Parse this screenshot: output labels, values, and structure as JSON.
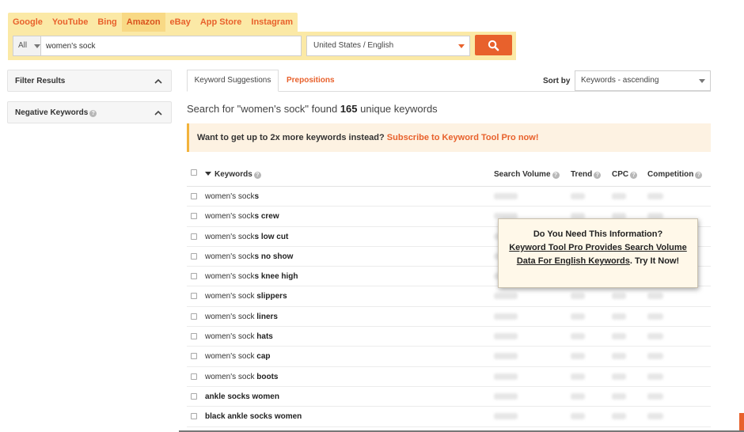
{
  "source_tabs": [
    {
      "label": "Google",
      "active": false
    },
    {
      "label": "YouTube",
      "active": false
    },
    {
      "label": "Bing",
      "active": false
    },
    {
      "label": "Amazon",
      "active": true
    },
    {
      "label": "eBay",
      "active": false
    },
    {
      "label": "App Store",
      "active": false
    },
    {
      "label": "Instagram",
      "active": false
    }
  ],
  "search": {
    "category": "All",
    "query": "women's sock",
    "location": "United States / English",
    "button_icon": "search-icon"
  },
  "sidebar": {
    "filter_results": "Filter Results",
    "negative_keywords": "Negative Keywords"
  },
  "main_tabs": {
    "suggestions": "Keyword Suggestions",
    "prepositions": "Prepositions"
  },
  "sort": {
    "label": "Sort by",
    "value": "Keywords - ascending"
  },
  "summary": {
    "prefix": "Search for \"women's sock\" found ",
    "count": "165",
    "suffix": " unique keywords"
  },
  "promo": {
    "text": "Want to get up to 2x more keywords instead? ",
    "link": "Subscribe to Keyword Tool Pro now!"
  },
  "table": {
    "headers": {
      "keywords": "Keywords",
      "search_volume": "Search Volume",
      "trend": "Trend",
      "cpc": "CPC",
      "competition": "Competition"
    },
    "rows": [
      {
        "base": "women's sock",
        "bold": "s"
      },
      {
        "base": "women's sock",
        "bold": "s crew"
      },
      {
        "base": "women's sock",
        "bold": "s low cut"
      },
      {
        "base": "women's sock",
        "bold": "s no show"
      },
      {
        "base": "women's sock",
        "bold": "s knee high"
      },
      {
        "base": "women's sock",
        "bold": " slippers"
      },
      {
        "base": "women's sock",
        "bold": " liners"
      },
      {
        "base": "women's sock",
        "bold": " hats"
      },
      {
        "base": "women's sock",
        "bold": " cap"
      },
      {
        "base": "women's sock",
        "bold": " boots"
      },
      {
        "base": "",
        "bold": "ankle socks women"
      },
      {
        "base": "",
        "bold": "black ankle socks women"
      }
    ]
  },
  "popup": {
    "line1": "Do You Need This Information?",
    "link": "Keyword Tool Pro Provides Search Volume Data For English Keywords",
    "tail": ". Try It Now!"
  },
  "colors": {
    "accent": "#e8612c",
    "search_bg": "#fbe9a6",
    "promo_bg": "#fdf2e2",
    "popup_bg": "#fff8e9"
  }
}
